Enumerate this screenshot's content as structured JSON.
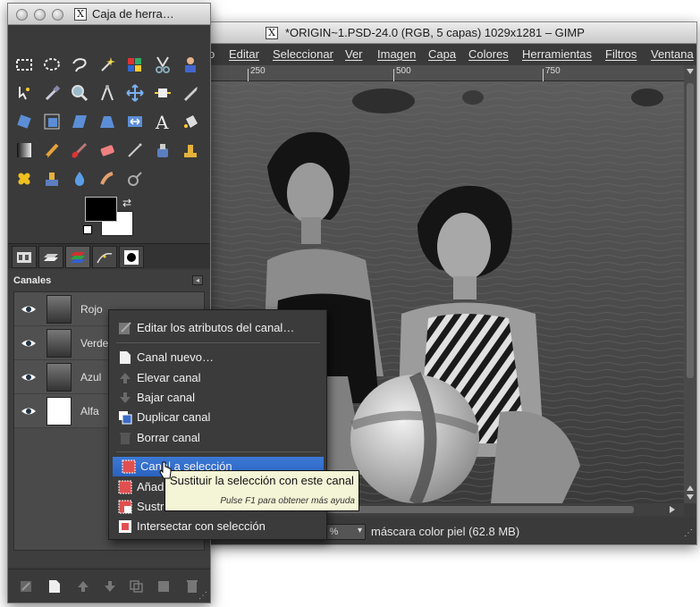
{
  "toolbox": {
    "title": "Caja de herra…",
    "title_icon": "X",
    "tabs": [
      "tool-options-icon",
      "layers-icon",
      "channels-icon",
      "paths-icon",
      "brushes-icon"
    ],
    "channels": {
      "title": "Canales",
      "rows": [
        {
          "name": "Rojo",
          "visible": true
        },
        {
          "name": "Verde",
          "visible": true
        },
        {
          "name": "Azul",
          "visible": true
        },
        {
          "name": "Alfa",
          "visible": true
        }
      ]
    },
    "colors": {
      "foreground": "#000000",
      "background": "#ffffff"
    }
  },
  "image_window": {
    "title": "*ORIGIN~1.PSD-24.0 (RGB, 5 capas) 1029x1281 – GIMP",
    "title_icon": "X",
    "menu": [
      "o",
      "Editar",
      "Seleccionar",
      "Ver",
      "Imagen",
      "Capa",
      "Colores",
      "Herramientas",
      "Filtros",
      "Ventana"
    ],
    "ruler_labels": [
      "250",
      "500",
      "750"
    ],
    "zoom": "66.7 %",
    "status": "máscara color piel (62.8 MB)"
  },
  "context_menu": {
    "items": [
      {
        "label": "Editar los atributos del canal…",
        "icon": "edit-attributes-icon"
      },
      {
        "label": "Canal nuevo…",
        "icon": "new-channel-icon"
      },
      {
        "label": "Elevar canal",
        "icon": "raise-icon"
      },
      {
        "label": "Bajar canal",
        "icon": "lower-icon"
      },
      {
        "label": "Duplicar canal",
        "icon": "duplicate-icon"
      },
      {
        "label": "Borrar canal",
        "icon": "delete-icon"
      },
      {
        "label": "Canal a selección",
        "icon": "channel-to-selection-icon",
        "highlighted": true
      },
      {
        "label": "Añadir a la selección",
        "icon": "add-to-selection-icon"
      },
      {
        "label": "Sustraer de la selección",
        "icon": "subtract-from-selection-icon"
      },
      {
        "label": "Intersectar con selección",
        "icon": "intersect-selection-icon"
      }
    ]
  },
  "tooltip": {
    "text": "Sustituir la selección con este canal",
    "hint": "Pulse F1 para obtener más ayuda"
  },
  "accent_color": "#2f6ccc"
}
